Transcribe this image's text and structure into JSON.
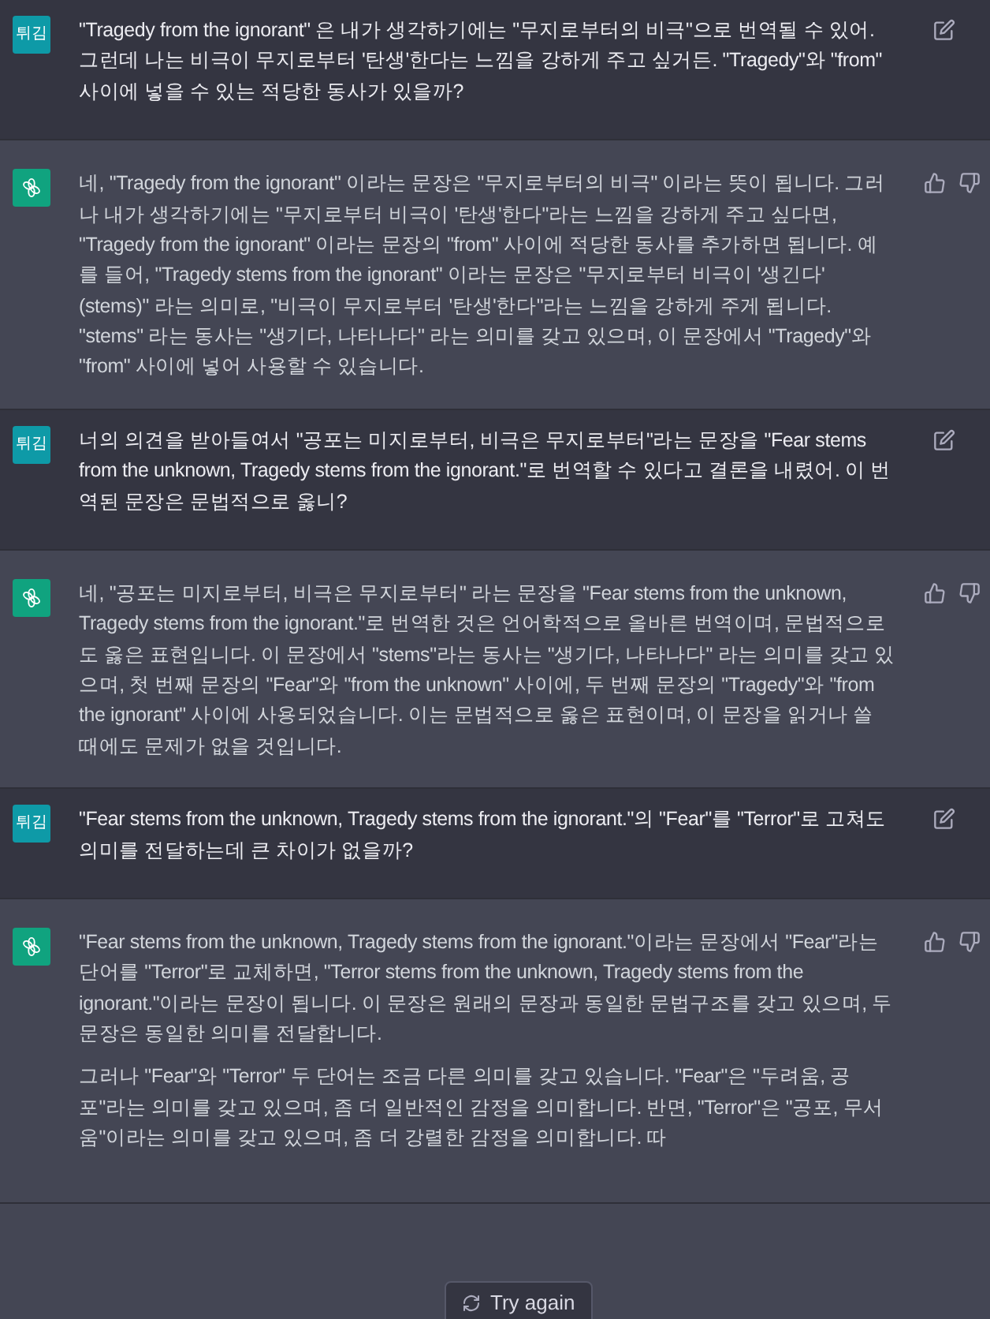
{
  "messages": [
    {
      "kind": "user",
      "avatar": "튀김",
      "paragraphs": [
        "\"Tragedy from the ignorant\" 은 내가 생각하기에는 \"무지로부터의 비극\"으로 번역될 수 있어. 그런데 나는 비극이 무지로부터 '탄생'한다는 느낌을 강하게 주고 싶거든. \"Tragedy\"와 \"from\" 사이에 넣을 수 있는 적당한 동사가 있을까?"
      ]
    },
    {
      "kind": "assistant",
      "paragraphs": [
        "네, \"Tragedy from the ignorant\" 이라는 문장은 \"무지로부터의 비극\" 이라는 뜻이 됩니다. 그러나 내가 생각하기에는 \"무지로부터 비극이 '탄생'한다\"라는 느낌을 강하게 주고 싶다면, \"Tragedy from the ignorant\" 이라는 문장의 \"from\" 사이에 적당한 동사를 추가하면 됩니다. 예를 들어, \"Tragedy stems from the ignorant\" 이라는 문장은 \"무지로부터 비극이 '생긴다' (stems)\" 라는 의미로, \"비극이 무지로부터 '탄생'한다\"라는 느낌을 강하게 주게 됩니다. \"stems\" 라는 동사는 \"생기다, 나타나다\" 라는 의미를 갖고 있으며, 이 문장에서 \"Tragedy\"와 \"from\" 사이에 넣어 사용할 수 있습니다."
      ]
    },
    {
      "kind": "user",
      "avatar": "튀김",
      "paragraphs": [
        "너의 의견을 받아들여서 \"공포는 미지로부터, 비극은 무지로부터\"라는 문장을 \"Fear stems from the unknown, Tragedy stems from the ignorant.\"로 번역할 수 있다고 결론을 내렸어. 이 번역된 문장은 문법적으로 옳니?"
      ]
    },
    {
      "kind": "assistant",
      "paragraphs": [
        "네, \"공포는 미지로부터, 비극은 무지로부터\" 라는 문장을 \"Fear stems from the unknown, Tragedy stems from the ignorant.\"로 번역한 것은 언어학적으로 올바른 번역이며, 문법적으로도 옳은 표현입니다. 이 문장에서 \"stems\"라는 동사는 \"생기다, 나타나다\" 라는 의미를 갖고 있으며, 첫 번째 문장의 \"Fear\"와 \"from the unknown\" 사이에, 두 번째 문장의 \"Tragedy\"와 \"from the ignorant\" 사이에 사용되었습니다. 이는 문법적으로 옳은 표현이며, 이 문장을 읽거나 쓸 때에도 문제가 없을 것입니다."
      ]
    },
    {
      "kind": "user",
      "avatar": "튀김",
      "paragraphs": [
        "\"Fear stems from the unknown, Tragedy stems from the ignorant.\"의 \"Fear\"를 \"Terror\"로 고쳐도 의미를 전달하는데 큰 차이가 없을까?"
      ]
    },
    {
      "kind": "assistant",
      "paragraphs": [
        "\"Fear stems from the unknown, Tragedy stems from the ignorant.\"이라는 문장에서 \"Fear\"라는 단어를 \"Terror\"로 교체하면, \"Terror stems from the unknown, Tragedy stems from the ignorant.\"이라는 문장이 됩니다. 이 문장은 원래의 문장과 동일한 문법구조를 갖고 있으며, 두 문장은 동일한 의미를 전달합니다.",
        "그러나 \"Fear\"와 \"Terror\" 두 단어는 조금 다른 의미를 갖고 있습니다. \"Fear\"은 \"두려움, 공포\"라는 의미를 갖고 있으며, 좀 더 일반적인 감정을 의미합니다. 반면, \"Terror\"은 \"공포, 무서움\"이라는 의미를 갖고 있으며, 좀 더 강렬한 감정을 의미합니다. 따"
      ]
    }
  ],
  "retry_button": "Try again"
}
